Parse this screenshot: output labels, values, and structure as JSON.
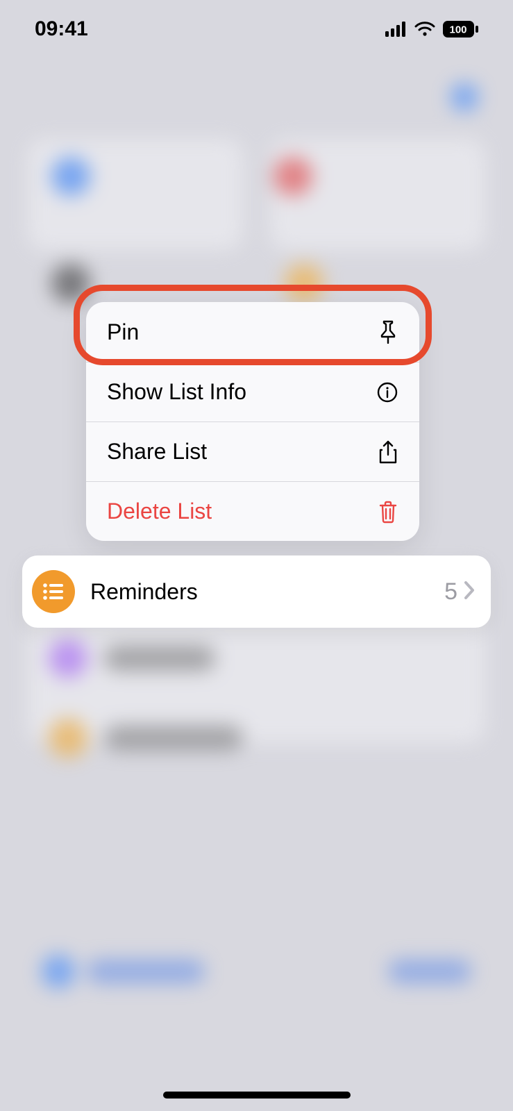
{
  "status_bar": {
    "time": "09:41",
    "battery_text": "100"
  },
  "context_menu": {
    "items": [
      {
        "label": "Pin",
        "icon": "pin-icon",
        "destructive": false
      },
      {
        "label": "Show List Info",
        "icon": "info-icon",
        "destructive": false
      },
      {
        "label": "Share List",
        "icon": "share-icon",
        "destructive": false
      },
      {
        "label": "Delete List",
        "icon": "trash-icon",
        "destructive": true
      }
    ]
  },
  "selected_list": {
    "name": "Reminders",
    "count": "5",
    "icon_color": "#f19a2c"
  },
  "highlight": {
    "target": "pin-menu-item"
  }
}
